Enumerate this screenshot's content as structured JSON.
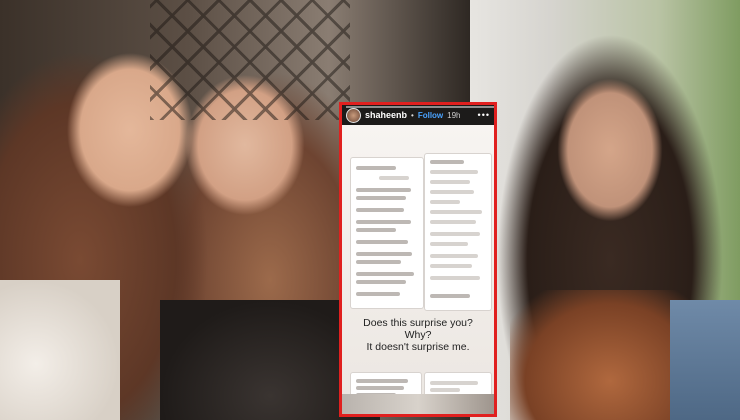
{
  "story": {
    "username": "shaheenb",
    "separator": "•",
    "follow_label": "Follow",
    "age": "19h",
    "more": "•••",
    "caption_lines": [
      "Does this surprise you?",
      "Why?",
      "It doesn't surprise me."
    ]
  },
  "colors": {
    "frame": "#e0201f",
    "follow": "#4aa3ff",
    "header_bg": "#1c1b1a"
  }
}
